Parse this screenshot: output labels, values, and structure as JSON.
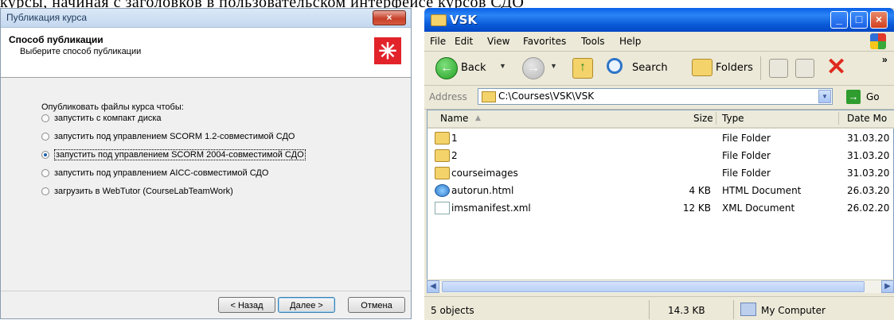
{
  "top_text": "курсы, начиная с заголовков в пользовательском интерфейсе курсов СДО",
  "dialog": {
    "title": "Публикация курса",
    "close_glyph": "×",
    "header_title": "Способ публикации",
    "header_subtitle": "Выберите способ публикации",
    "prompt": "Опубликовать файлы курса чтобы:",
    "options": [
      {
        "label": "запустить с компакт диска",
        "checked": false
      },
      {
        "label": "запустить под управлением SCORM 1.2-совместимой СДО",
        "checked": false
      },
      {
        "label": "запустить под управлением SCORM 2004-совместимой СДО",
        "checked": true
      },
      {
        "label": "запустить под управлением AICC-совместимой СДО",
        "checked": false
      },
      {
        "label": "загрузить в WebTutor (CourseLabTeamWork)",
        "checked": false
      }
    ],
    "buttons": {
      "back": "< Назад",
      "next": "Далее >",
      "cancel": "Отмена"
    }
  },
  "explorer": {
    "title": "VSK",
    "menu": [
      "File",
      "Edit",
      "View",
      "Favorites",
      "Tools",
      "Help"
    ],
    "toolbar": {
      "back": "Back",
      "search": "Search",
      "folders": "Folders"
    },
    "address_label": "Address",
    "address_value": "C:\\Courses\\VSK\\VSK",
    "go_label": "Go",
    "columns": {
      "name": "Name",
      "size": "Size",
      "type": "Type",
      "date": "Date Mo"
    },
    "files": [
      {
        "name": "1",
        "size": "",
        "type": "File Folder",
        "date": "31.03.20",
        "icon": "folder-icon"
      },
      {
        "name": "2",
        "size": "",
        "type": "File Folder",
        "date": "31.03.20",
        "icon": "folder-icon"
      },
      {
        "name": "courseimages",
        "size": "",
        "type": "File Folder",
        "date": "31.03.20",
        "icon": "folder-icon"
      },
      {
        "name": "autorun.html",
        "size": "4 KB",
        "type": "HTML Document",
        "date": "26.03.20",
        "icon": "html-file-icon"
      },
      {
        "name": "imsmanifest.xml",
        "size": "12 KB",
        "type": "XML Document",
        "date": "26.02.20",
        "icon": "xml-file-icon"
      }
    ],
    "status": {
      "objects": "5 objects",
      "size": "14.3 KB",
      "location": "My Computer"
    }
  }
}
